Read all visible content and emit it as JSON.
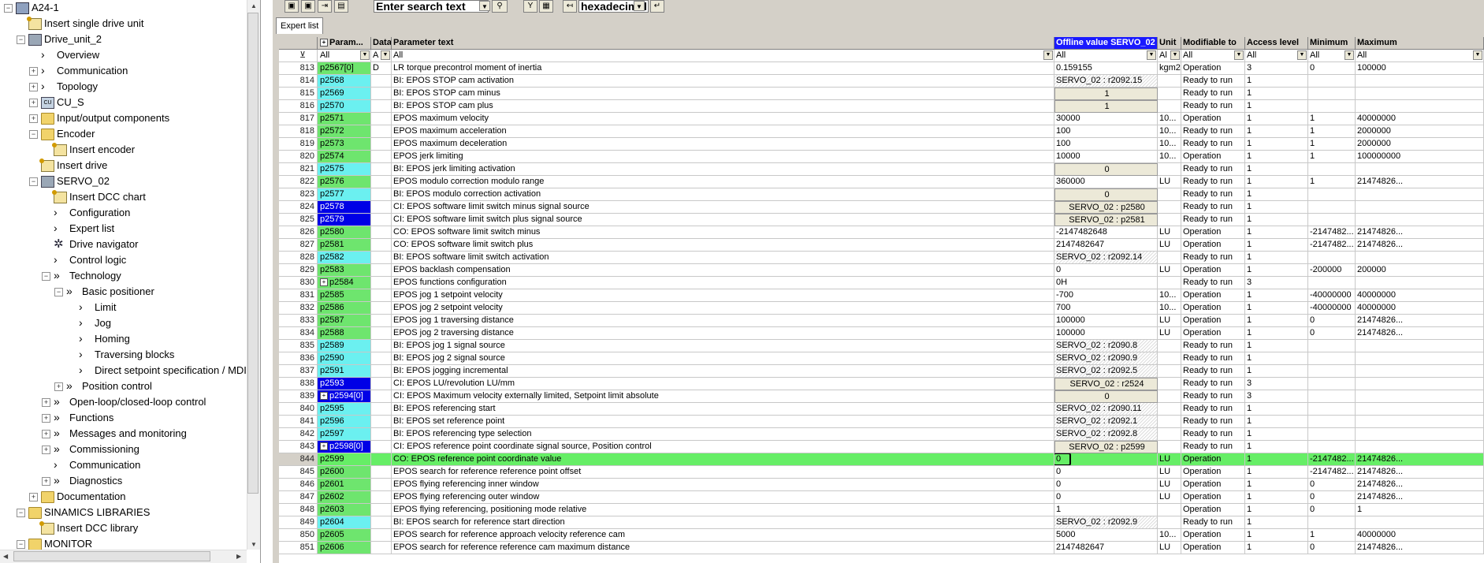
{
  "tree": {
    "nodes": [
      {
        "label": "A24-1",
        "icon": "project-icon",
        "level": 0,
        "exp": "minus"
      },
      {
        "label": "Insert single drive unit",
        "icon": "insert-icon",
        "level": 1,
        "exp": null
      },
      {
        "label": "Drive_unit_2",
        "icon": "drive-unit-icon",
        "level": 1,
        "exp": "minus"
      },
      {
        "label": "Overview",
        "icon": "chevron-icon",
        "level": 2,
        "exp": null
      },
      {
        "label": "Communication",
        "icon": "chevron-icon",
        "level": 2,
        "exp": "plus"
      },
      {
        "label": "Topology",
        "icon": "chevron-icon",
        "level": 2,
        "exp": "plus"
      },
      {
        "label": "CU_S",
        "icon": "cu-icon",
        "level": 2,
        "exp": "plus"
      },
      {
        "label": "Input/output components",
        "icon": "folder-icon",
        "level": 2,
        "exp": "plus"
      },
      {
        "label": "Encoder",
        "icon": "folder-icon",
        "level": 2,
        "exp": "minus"
      },
      {
        "label": "Insert encoder",
        "icon": "insert-icon",
        "level": 3,
        "exp": null
      },
      {
        "label": "Insert drive",
        "icon": "insert-icon",
        "level": 2,
        "exp": null
      },
      {
        "label": "SERVO_02",
        "icon": "servo-icon",
        "level": 2,
        "exp": "minus"
      },
      {
        "label": "Insert DCC chart",
        "icon": "insert-icon",
        "level": 3,
        "exp": null
      },
      {
        "label": "Configuration",
        "icon": "chevron-icon",
        "level": 3,
        "exp": null
      },
      {
        "label": "Expert list",
        "icon": "chevron-icon",
        "level": 3,
        "exp": null
      },
      {
        "label": "Drive navigator",
        "icon": "gear-icon",
        "level": 3,
        "exp": null
      },
      {
        "label": "Control logic",
        "icon": "chevron-icon",
        "level": 3,
        "exp": null
      },
      {
        "label": "Technology",
        "icon": "double-chevron-icon",
        "level": 3,
        "exp": "minus"
      },
      {
        "label": "Basic positioner",
        "icon": "double-chevron-icon",
        "level": 4,
        "exp": "minus"
      },
      {
        "label": "Limit",
        "icon": "chevron-icon",
        "level": 5,
        "exp": null
      },
      {
        "label": "Jog",
        "icon": "chevron-icon",
        "level": 5,
        "exp": null
      },
      {
        "label": "Homing",
        "icon": "chevron-icon",
        "level": 5,
        "exp": null
      },
      {
        "label": "Traversing blocks",
        "icon": "chevron-icon",
        "level": 5,
        "exp": null
      },
      {
        "label": "Direct setpoint specification / MDI",
        "icon": "chevron-icon",
        "level": 5,
        "exp": null
      },
      {
        "label": "Position control",
        "icon": "double-chevron-icon",
        "level": 4,
        "exp": "plus"
      },
      {
        "label": "Open-loop/closed-loop control",
        "icon": "double-chevron-icon",
        "level": 3,
        "exp": "plus"
      },
      {
        "label": "Functions",
        "icon": "double-chevron-icon",
        "level": 3,
        "exp": "plus"
      },
      {
        "label": "Messages and monitoring",
        "icon": "double-chevron-icon",
        "level": 3,
        "exp": "plus"
      },
      {
        "label": "Commissioning",
        "icon": "double-chevron-icon",
        "level": 3,
        "exp": "plus"
      },
      {
        "label": "Communication",
        "icon": "chevron-icon",
        "level": 3,
        "exp": null
      },
      {
        "label": "Diagnostics",
        "icon": "double-chevron-icon",
        "level": 3,
        "exp": "plus"
      },
      {
        "label": "Documentation",
        "icon": "folder-icon",
        "level": 2,
        "exp": "plus"
      },
      {
        "label": "SINAMICS LIBRARIES",
        "icon": "folder-icon",
        "level": 1,
        "exp": "minus"
      },
      {
        "label": "Insert DCC library",
        "icon": "insert-icon",
        "level": 2,
        "exp": null
      },
      {
        "label": "MONITOR",
        "icon": "folder-icon",
        "level": 1,
        "exp": "minus"
      }
    ]
  },
  "toolbar": {
    "search_placeholder": "Enter search text",
    "number_format": "hexadecimal"
  },
  "tabs": [
    {
      "label": "Expert list",
      "active": true
    }
  ],
  "grid": {
    "headers": [
      "",
      "Param...",
      "Data",
      "Parameter text",
      "Offline value SERVO_02",
      "Unit",
      "Modifiable to",
      "Access level",
      "Minimum",
      "Maximum"
    ],
    "filters": [
      "",
      "All",
      "A",
      "All",
      "All",
      "Al",
      "All",
      "All",
      "All",
      "All"
    ],
    "rows": [
      {
        "idx": "813",
        "param": "p2567[0]",
        "pc": "green",
        "data": "D",
        "text": "LR torque precontrol moment of inertia",
        "value": "0.159155",
        "vs": "plain",
        "unit": "kgm2",
        "mod": "Operation",
        "acc": "3",
        "min": "0",
        "max": "100000"
      },
      {
        "idx": "814",
        "param": "p2568",
        "pc": "cyan",
        "data": "",
        "text": "BI: EPOS STOP cam activation",
        "value": "SERVO_02 : r2092.15",
        "vs": "hatch",
        "unit": "",
        "mod": "Ready to run",
        "acc": "1",
        "min": "",
        "max": ""
      },
      {
        "idx": "815",
        "param": "p2569",
        "pc": "cyan",
        "data": "",
        "text": "BI: EPOS STOP cam minus",
        "value": "1",
        "vs": "btn",
        "unit": "",
        "mod": "Ready to run",
        "acc": "1",
        "min": "",
        "max": ""
      },
      {
        "idx": "816",
        "param": "p2570",
        "pc": "cyan",
        "data": "",
        "text": "BI: EPOS STOP cam plus",
        "value": "1",
        "vs": "btn",
        "unit": "",
        "mod": "Ready to run",
        "acc": "1",
        "min": "",
        "max": ""
      },
      {
        "idx": "817",
        "param": "p2571",
        "pc": "green",
        "data": "",
        "text": "EPOS maximum velocity",
        "value": "30000",
        "vs": "plain",
        "unit": "10...",
        "mod": "Operation",
        "acc": "1",
        "min": "1",
        "max": "40000000"
      },
      {
        "idx": "818",
        "param": "p2572",
        "pc": "green",
        "data": "",
        "text": "EPOS maximum acceleration",
        "value": "100",
        "vs": "plain",
        "unit": "10...",
        "mod": "Ready to run",
        "acc": "1",
        "min": "1",
        "max": "2000000"
      },
      {
        "idx": "819",
        "param": "p2573",
        "pc": "green",
        "data": "",
        "text": "EPOS maximum deceleration",
        "value": "100",
        "vs": "plain",
        "unit": "10...",
        "mod": "Ready to run",
        "acc": "1",
        "min": "1",
        "max": "2000000"
      },
      {
        "idx": "820",
        "param": "p2574",
        "pc": "green",
        "data": "",
        "text": "EPOS jerk limiting",
        "value": "10000",
        "vs": "plain",
        "unit": "10...",
        "mod": "Operation",
        "acc": "1",
        "min": "1",
        "max": "100000000"
      },
      {
        "idx": "821",
        "param": "p2575",
        "pc": "cyan",
        "data": "",
        "text": "BI: EPOS jerk limiting activation",
        "value": "0",
        "vs": "btn",
        "unit": "",
        "mod": "Ready to run",
        "acc": "1",
        "min": "",
        "max": ""
      },
      {
        "idx": "822",
        "param": "p2576",
        "pc": "green",
        "data": "",
        "text": "EPOS modulo correction modulo range",
        "value": "360000",
        "vs": "plain",
        "unit": "LU",
        "mod": "Ready to run",
        "acc": "1",
        "min": "1",
        "max": "21474826..."
      },
      {
        "idx": "823",
        "param": "p2577",
        "pc": "cyan",
        "data": "",
        "text": "BI: EPOS modulo correction activation",
        "value": "0",
        "vs": "btn",
        "unit": "",
        "mod": "Ready to run",
        "acc": "1",
        "min": "",
        "max": ""
      },
      {
        "idx": "824",
        "param": "p2578",
        "pc": "blue",
        "data": "",
        "text": "CI: EPOS software limit switch minus signal source",
        "value": "SERVO_02 : p2580",
        "vs": "btn",
        "unit": "",
        "mod": "Ready to run",
        "acc": "1",
        "min": "",
        "max": ""
      },
      {
        "idx": "825",
        "param": "p2579",
        "pc": "blue",
        "data": "",
        "text": "CI: EPOS software limit switch plus signal source",
        "value": "SERVO_02 : p2581",
        "vs": "btn",
        "unit": "",
        "mod": "Ready to run",
        "acc": "1",
        "min": "",
        "max": ""
      },
      {
        "idx": "826",
        "param": "p2580",
        "pc": "green",
        "data": "",
        "text": "CO: EPOS software limit switch minus",
        "value": "-2147482648",
        "vs": "plain",
        "unit": "LU",
        "mod": "Operation",
        "acc": "1",
        "min": "-2147482...",
        "max": "21474826..."
      },
      {
        "idx": "827",
        "param": "p2581",
        "pc": "green",
        "data": "",
        "text": "CO: EPOS software limit switch plus",
        "value": "2147482647",
        "vs": "plain",
        "unit": "LU",
        "mod": "Operation",
        "acc": "1",
        "min": "-2147482...",
        "max": "21474826..."
      },
      {
        "idx": "828",
        "param": "p2582",
        "pc": "cyan",
        "data": "",
        "text": "BI: EPOS software limit switch activation",
        "value": "SERVO_02 : r2092.14",
        "vs": "hatch",
        "unit": "",
        "mod": "Ready to run",
        "acc": "1",
        "min": "",
        "max": ""
      },
      {
        "idx": "829",
        "param": "p2583",
        "pc": "green",
        "data": "",
        "text": "EPOS backlash compensation",
        "value": "0",
        "vs": "plain",
        "unit": "LU",
        "mod": "Operation",
        "acc": "1",
        "min": "-200000",
        "max": "200000"
      },
      {
        "idx": "830",
        "param": "p2584",
        "pc": "green",
        "plus": true,
        "data": "",
        "text": "EPOS functions configuration",
        "value": "0H",
        "vs": "plain",
        "unit": "",
        "mod": "Ready to run",
        "acc": "3",
        "min": "",
        "max": ""
      },
      {
        "idx": "831",
        "param": "p2585",
        "pc": "green",
        "data": "",
        "text": "EPOS jog 1 setpoint velocity",
        "value": "-700",
        "vs": "plain",
        "unit": "10...",
        "mod": "Operation",
        "acc": "1",
        "min": "-40000000",
        "max": "40000000"
      },
      {
        "idx": "832",
        "param": "p2586",
        "pc": "green",
        "data": "",
        "text": "EPOS jog 2 setpoint velocity",
        "value": "700",
        "vs": "plain",
        "unit": "10...",
        "mod": "Operation",
        "acc": "1",
        "min": "-40000000",
        "max": "40000000"
      },
      {
        "idx": "833",
        "param": "p2587",
        "pc": "green",
        "data": "",
        "text": "EPOS jog 1 traversing distance",
        "value": "100000",
        "vs": "plain",
        "unit": "LU",
        "mod": "Operation",
        "acc": "1",
        "min": "0",
        "max": "21474826..."
      },
      {
        "idx": "834",
        "param": "p2588",
        "pc": "green",
        "data": "",
        "text": "EPOS jog 2 traversing distance",
        "value": "100000",
        "vs": "plain",
        "unit": "LU",
        "mod": "Operation",
        "acc": "1",
        "min": "0",
        "max": "21474826..."
      },
      {
        "idx": "835",
        "param": "p2589",
        "pc": "cyan",
        "data": "",
        "text": "BI: EPOS jog 1 signal source",
        "value": "SERVO_02 : r2090.8",
        "vs": "hatch",
        "unit": "",
        "mod": "Ready to run",
        "acc": "1",
        "min": "",
        "max": ""
      },
      {
        "idx": "836",
        "param": "p2590",
        "pc": "cyan",
        "data": "",
        "text": "BI: EPOS jog 2 signal source",
        "value": "SERVO_02 : r2090.9",
        "vs": "hatch",
        "unit": "",
        "mod": "Ready to run",
        "acc": "1",
        "min": "",
        "max": ""
      },
      {
        "idx": "837",
        "param": "p2591",
        "pc": "cyan",
        "data": "",
        "text": "BI: EPOS jogging incremental",
        "value": "SERVO_02 : r2092.5",
        "vs": "hatch",
        "unit": "",
        "mod": "Ready to run",
        "acc": "1",
        "min": "",
        "max": ""
      },
      {
        "idx": "838",
        "param": "p2593",
        "pc": "blue",
        "data": "",
        "text": "CI: EPOS LU/revolution LU/mm",
        "value": "SERVO_02 : r2524",
        "vs": "btn",
        "unit": "",
        "mod": "Ready to run",
        "acc": "3",
        "min": "",
        "max": ""
      },
      {
        "idx": "839",
        "param": "p2594[0]",
        "pc": "blue",
        "plus": true,
        "data": "",
        "text": "CI: EPOS Maximum velocity externally limited, Setpoint limit absolute",
        "value": "0",
        "vs": "btn",
        "unit": "",
        "mod": "Ready to run",
        "acc": "3",
        "min": "",
        "max": ""
      },
      {
        "idx": "840",
        "param": "p2595",
        "pc": "cyan",
        "data": "",
        "text": "BI: EPOS referencing start",
        "value": "SERVO_02 : r2090.11",
        "vs": "hatch",
        "unit": "",
        "mod": "Ready to run",
        "acc": "1",
        "min": "",
        "max": ""
      },
      {
        "idx": "841",
        "param": "p2596",
        "pc": "cyan",
        "data": "",
        "text": "BI: EPOS set reference point",
        "value": "SERVO_02 : r2092.1",
        "vs": "hatch",
        "unit": "",
        "mod": "Ready to run",
        "acc": "1",
        "min": "",
        "max": ""
      },
      {
        "idx": "842",
        "param": "p2597",
        "pc": "cyan",
        "data": "",
        "text": "BI: EPOS referencing type selection",
        "value": "SERVO_02 : r2092.8",
        "vs": "hatch",
        "unit": "",
        "mod": "Ready to run",
        "acc": "1",
        "min": "",
        "max": ""
      },
      {
        "idx": "843",
        "param": "p2598[0]",
        "pc": "blue",
        "plus": true,
        "data": "",
        "text": "CI: EPOS reference point coordinate signal source, Position control",
        "value": "SERVO_02 : p2599",
        "vs": "btn",
        "unit": "",
        "mod": "Ready to run",
        "acc": "1",
        "min": "",
        "max": ""
      },
      {
        "idx": "844",
        "param": "p2599",
        "pc": "green",
        "data": "",
        "text": "CO: EPOS reference point coordinate value",
        "value": "0",
        "vs": "focus",
        "unit": "LU",
        "mod": "Operation",
        "acc": "1",
        "min": "-2147482...",
        "max": "21474826...",
        "sel": true
      },
      {
        "idx": "845",
        "param": "p2600",
        "pc": "green",
        "data": "",
        "text": "EPOS search for reference reference point offset",
        "value": "0",
        "vs": "plain",
        "unit": "LU",
        "mod": "Operation",
        "acc": "1",
        "min": "-2147482...",
        "max": "21474826..."
      },
      {
        "idx": "846",
        "param": "p2601",
        "pc": "green",
        "data": "",
        "text": "EPOS flying referencing inner window",
        "value": "0",
        "vs": "plain",
        "unit": "LU",
        "mod": "Operation",
        "acc": "1",
        "min": "0",
        "max": "21474826..."
      },
      {
        "idx": "847",
        "param": "p2602",
        "pc": "green",
        "data": "",
        "text": "EPOS flying referencing outer window",
        "value": "0",
        "vs": "plain",
        "unit": "LU",
        "mod": "Operation",
        "acc": "1",
        "min": "0",
        "max": "21474826..."
      },
      {
        "idx": "848",
        "param": "p2603",
        "pc": "green",
        "data": "",
        "text": "EPOS flying referencing, positioning mode relative",
        "value": "1",
        "vs": "plain",
        "unit": "",
        "mod": "Operation",
        "acc": "1",
        "min": "0",
        "max": "1"
      },
      {
        "idx": "849",
        "param": "p2604",
        "pc": "cyan",
        "data": "",
        "text": "BI: EPOS search for reference start direction",
        "value": "SERVO_02 : r2092.9",
        "vs": "hatch",
        "unit": "",
        "mod": "Ready to run",
        "acc": "1",
        "min": "",
        "max": ""
      },
      {
        "idx": "850",
        "param": "p2605",
        "pc": "green",
        "data": "",
        "text": "EPOS search for reference approach velocity reference cam",
        "value": "5000",
        "vs": "plain",
        "unit": "10...",
        "mod": "Operation",
        "acc": "1",
        "min": "1",
        "max": "40000000"
      },
      {
        "idx": "851",
        "param": "p2606",
        "pc": "green",
        "data": "",
        "text": "EPOS search for reference reference cam maximum distance",
        "value": "2147482647",
        "vs": "plain",
        "unit": "LU",
        "mod": "Operation",
        "acc": "1",
        "min": "0",
        "max": "21474826..."
      }
    ]
  }
}
